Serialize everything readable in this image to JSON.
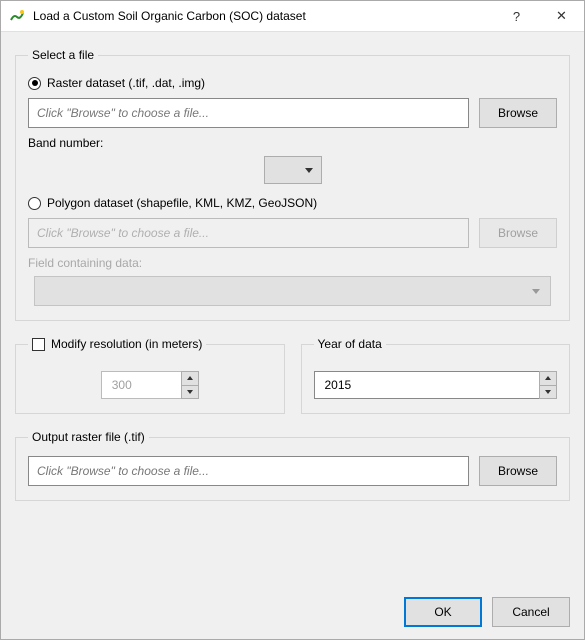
{
  "window": {
    "title": "Load a Custom Soil Organic Carbon (SOC) dataset",
    "help_glyph": "?",
    "close_glyph": "✕"
  },
  "select_file": {
    "legend": "Select a file",
    "raster": {
      "label": "Raster dataset (.tif, .dat, .img)",
      "checked": true,
      "placeholder": "Click \"Browse\" to choose a file...",
      "browse": "Browse",
      "band_label": "Band number:"
    },
    "polygon": {
      "label": "Polygon dataset (shapefile, KML, KMZ, GeoJSON)",
      "checked": false,
      "placeholder": "Click \"Browse\" to choose a file...",
      "browse": "Browse",
      "field_label": "Field containing data:"
    }
  },
  "resolution": {
    "legend": "Modify resolution (in meters)",
    "checked": false,
    "value": "300"
  },
  "year": {
    "legend": "Year of data",
    "value": "2015"
  },
  "output": {
    "legend": "Output raster file (.tif)",
    "placeholder": "Click \"Browse\" to choose a file...",
    "browse": "Browse"
  },
  "buttons": {
    "ok": "OK",
    "cancel": "Cancel"
  }
}
